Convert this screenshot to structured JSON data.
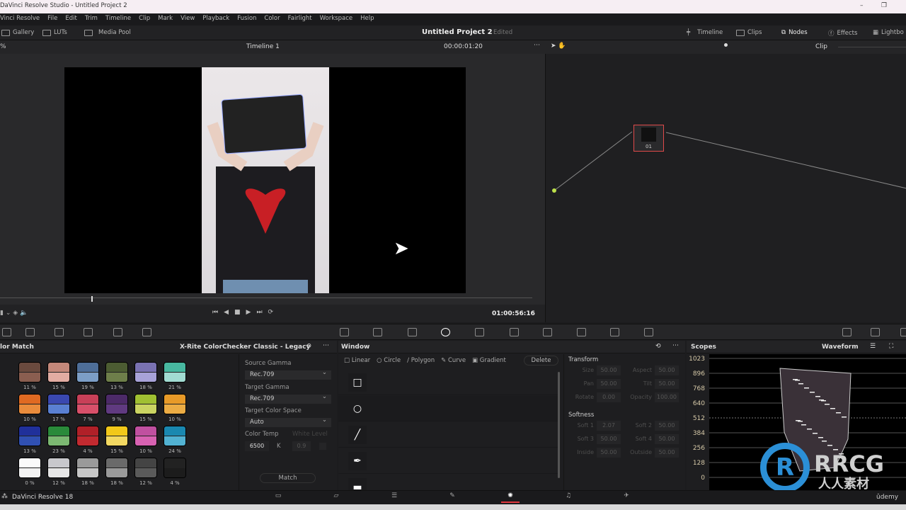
{
  "window": {
    "title": "DaVinci Resolve Studio - Untitled Project 2",
    "controls": [
      "–",
      "❐",
      "✕"
    ]
  },
  "menu": [
    "Vinci Resolve",
    "File",
    "Edit",
    "Trim",
    "Timeline",
    "Clip",
    "Mark",
    "View",
    "Playback",
    "Fusion",
    "Color",
    "Fairlight",
    "Workspace",
    "Help"
  ],
  "toolbar": {
    "left": [
      "Gallery",
      "LUTs",
      "Media Pool"
    ],
    "project": "Untitled Project 2",
    "status": "Edited",
    "right": [
      "Timeline",
      "Clips",
      "Nodes",
      "Effects",
      "Lightbo"
    ]
  },
  "viewer": {
    "zoom": "%",
    "timeline": "Timeline 1",
    "timecode": "00:00:01:20",
    "playhead_timecode": "01:00:56:16"
  },
  "nodes": {
    "mode": "Clip",
    "node_label": "01"
  },
  "color_match": {
    "title": "lor Match",
    "chart": "X-Rite ColorChecker Classic - Legacy",
    "swatches": [
      {
        "top": "#6a4a3e",
        "bottom": "#8a5e50",
        "pct": "11 %"
      },
      {
        "top": "#c4887a",
        "bottom": "#e2aca2",
        "pct": "15 %"
      },
      {
        "top": "#4e6e98",
        "bottom": "#7c9ec6",
        "pct": "19 %"
      },
      {
        "top": "#4c5c32",
        "bottom": "#6e7e4a",
        "pct": "13 %"
      },
      {
        "top": "#7a72b2",
        "bottom": "#a8a2d8",
        "pct": "18 %"
      },
      {
        "top": "#48b8a0",
        "bottom": "#a2dcd2",
        "pct": "21 %"
      },
      {
        "top": "#e06a22",
        "bottom": "#ea8c3c",
        "pct": "10 %"
      },
      {
        "top": "#3a48b0",
        "bottom": "#5a80d2",
        "pct": "17 %"
      },
      {
        "top": "#c84058",
        "bottom": "#d8506a",
        "pct": "7 %"
      },
      {
        "top": "#4c2a68",
        "bottom": "#603a80",
        "pct": "9 %"
      },
      {
        "top": "#a0c032",
        "bottom": "#cad462",
        "pct": "15 %"
      },
      {
        "top": "#e89a28",
        "bottom": "#ecac44",
        "pct": "10 %"
      },
      {
        "top": "#20309a",
        "bottom": "#3050b2",
        "pct": "13 %"
      },
      {
        "top": "#2a8a3a",
        "bottom": "#7cb872",
        "pct": "23 %"
      },
      {
        "top": "#b02028",
        "bottom": "#c22a30",
        "pct": "4 %"
      },
      {
        "top": "#f2c81a",
        "bottom": "#f2d862",
        "pct": "15 %"
      },
      {
        "top": "#c050a0",
        "bottom": "#d862b2",
        "pct": "10 %"
      },
      {
        "top": "#1a88b0",
        "bottom": "#52b2d2",
        "pct": "24 %"
      },
      {
        "top": "#fafafa",
        "bottom": "#f2f2f2",
        "pct": "0 %"
      },
      {
        "top": "#c8c8cc",
        "bottom": "#e6e6e6",
        "pct": "12 %"
      },
      {
        "top": "#9a9a9a",
        "bottom": "#c6c6c6",
        "pct": "18 %"
      },
      {
        "top": "#6a6a6a",
        "bottom": "#9a9a9a",
        "pct": "18 %"
      },
      {
        "top": "#444444",
        "bottom": "#5a5a5a",
        "pct": "12 %"
      },
      {
        "top": "#222222",
        "bottom": "#1c1c1c",
        "pct": "4 %"
      }
    ],
    "source_gamma_label": "Source Gamma",
    "source_gamma": "Rec.709",
    "target_gamma_label": "Target Gamma",
    "target_gamma": "Rec.709",
    "target_cs_label": "Target Color Space",
    "target_cs": "Auto",
    "temp_label": "Color Temp",
    "temp": "6500",
    "temp_unit": "K",
    "white_label": "White Level",
    "white": "0.9",
    "match": "Match"
  },
  "window_panel": {
    "title": "Window",
    "tools": [
      "Linear",
      "Circle",
      "Polygon",
      "Curve",
      "Gradient"
    ],
    "delete": "Delete",
    "transform_title": "Transform",
    "transform": [
      [
        "Size",
        "50.00"
      ],
      [
        "Aspect",
        "50.00"
      ],
      [
        "Pan",
        "50.00"
      ],
      [
        "Tilt",
        "50.00"
      ],
      [
        "Rotate",
        "0.00"
      ],
      [
        "Opacity",
        "100.00"
      ]
    ],
    "softness_title": "Softness",
    "softness": [
      [
        "Soft 1",
        "2.07"
      ],
      [
        "Soft 2",
        "50.00"
      ],
      [
        "Soft 3",
        "50.00"
      ],
      [
        "Soft 4",
        "50.00"
      ],
      [
        "Inside",
        "50.00"
      ],
      [
        "Outside",
        "50.00"
      ]
    ]
  },
  "scopes": {
    "title": "Scopes",
    "mode": "Waveform",
    "ticks": [
      "1023",
      "896",
      "768",
      "640",
      "512",
      "384",
      "256",
      "128",
      "0"
    ]
  },
  "bottom": {
    "app": "DaVinci Resolve 18"
  },
  "watermark": {
    "logo": "RRCG",
    "sub": "人人素材",
    "udemy": "ûdemy"
  }
}
